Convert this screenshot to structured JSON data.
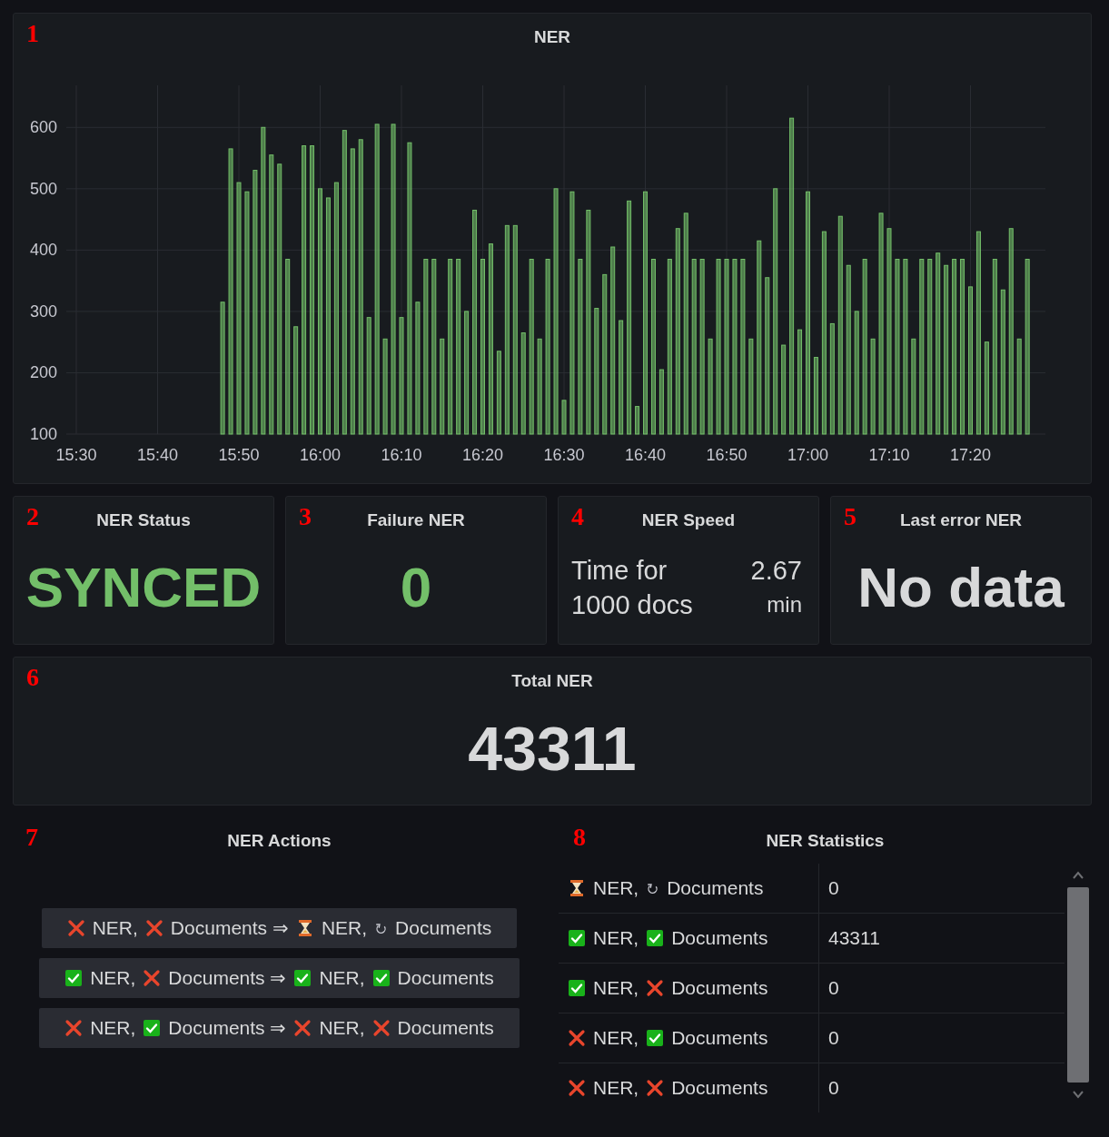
{
  "chart_panel": {
    "marker": "1",
    "title": "NER",
    "chart_data": {
      "type": "bar",
      "grid": true,
      "ylim": [
        100,
        670
      ],
      "yticks": [
        100,
        200,
        300,
        400,
        500,
        600
      ],
      "categories": [
        "15:30",
        null,
        null,
        null,
        null,
        null,
        null,
        null,
        null,
        null,
        "15:40",
        null,
        null,
        null,
        null,
        null,
        null,
        null,
        null,
        null,
        "15:50",
        null,
        null,
        null,
        null,
        null,
        null,
        null,
        null,
        null,
        "16:00",
        null,
        null,
        null,
        null,
        null,
        null,
        null,
        null,
        null,
        "16:10",
        null,
        null,
        null,
        null,
        null,
        null,
        null,
        null,
        null,
        "16:20",
        null,
        null,
        null,
        null,
        null,
        null,
        null,
        null,
        null,
        "16:30",
        null,
        null,
        null,
        null,
        null,
        null,
        null,
        null,
        null,
        "16:40",
        null,
        null,
        null,
        null,
        null,
        null,
        null,
        null,
        null,
        "16:50",
        null,
        null,
        null,
        null,
        null,
        null,
        null,
        null,
        null,
        "17:00",
        null,
        null,
        null,
        null,
        null,
        null,
        null,
        null,
        null,
        "17:10",
        null,
        null,
        null,
        null,
        null,
        null,
        null,
        null,
        null,
        "17:20",
        null,
        null,
        null,
        null,
        null,
        null,
        null,
        null,
        null
      ],
      "series": [
        {
          "color": "#73bf69",
          "values": [
            null,
            null,
            null,
            null,
            null,
            null,
            null,
            null,
            null,
            null,
            null,
            null,
            null,
            null,
            null,
            null,
            null,
            null,
            315,
            565,
            510,
            495,
            530,
            600,
            555,
            540,
            385,
            275,
            570,
            570,
            500,
            485,
            510,
            595,
            565,
            580,
            290,
            605,
            255,
            605,
            290,
            575,
            315,
            385,
            385,
            255,
            385,
            385,
            300,
            465,
            385,
            410,
            235,
            440,
            440,
            265,
            385,
            255,
            385,
            500,
            155,
            495,
            385,
            465,
            305,
            360,
            405,
            285,
            480,
            145,
            495,
            385,
            205,
            385,
            435,
            460,
            385,
            385,
            255,
            385,
            385,
            385,
            385,
            255,
            415,
            355,
            500,
            245,
            615,
            270,
            495,
            225,
            430,
            280,
            455,
            375,
            300,
            385,
            255,
            460,
            435,
            385,
            385,
            255,
            385,
            385,
            395,
            375,
            385,
            385,
            340,
            430,
            250,
            385,
            335,
            435,
            255,
            385,
            null,
            null
          ]
        }
      ]
    }
  },
  "stat_panels": [
    {
      "marker": "2",
      "title": "NER Status",
      "kind": "value",
      "value": "SYNCED",
      "color": "#73bf69"
    },
    {
      "marker": "3",
      "title": "Failure NER",
      "kind": "value",
      "value": "0",
      "color": "#73bf69"
    },
    {
      "marker": "4",
      "title": "NER Speed",
      "kind": "pair",
      "label": "Time for 1000 docs",
      "value": "2.67",
      "unit": "min",
      "color": "#d8d9da"
    },
    {
      "marker": "5",
      "title": "Last error NER",
      "kind": "value",
      "value": "No data",
      "color": "#d8d9da"
    }
  ],
  "total_panel": {
    "marker": "6",
    "title": "Total NER",
    "value": "43311"
  },
  "actions_panel": {
    "marker": "7",
    "title": "NER Actions",
    "actions": [
      {
        "from": [
          {
            "kind": "failed",
            "label": "NER,"
          },
          {
            "kind": "failed",
            "label": "Documents"
          }
        ],
        "arrow": "⇒",
        "to": [
          {
            "kind": "pending",
            "label": "NER,"
          },
          {
            "kind": "retry",
            "label": "Documents"
          }
        ]
      },
      {
        "from": [
          {
            "kind": "done",
            "label": "NER,"
          },
          {
            "kind": "failed",
            "label": "Documents"
          }
        ],
        "arrow": "⇒",
        "to": [
          {
            "kind": "done",
            "label": "NER,"
          },
          {
            "kind": "done",
            "label": "Documents"
          }
        ]
      },
      {
        "from": [
          {
            "kind": "failed",
            "label": "NER,"
          },
          {
            "kind": "done",
            "label": "Documents"
          }
        ],
        "arrow": "⇒",
        "to": [
          {
            "kind": "failed",
            "label": "NER,"
          },
          {
            "kind": "failed",
            "label": "Documents"
          }
        ]
      }
    ]
  },
  "statistics_panel": {
    "marker": "8",
    "title": "NER Statistics",
    "rows": [
      {
        "state": [
          {
            "kind": "pending",
            "label": "NER,"
          },
          {
            "kind": "retry",
            "label": "Documents"
          }
        ],
        "count": "0"
      },
      {
        "state": [
          {
            "kind": "done",
            "label": "NER,"
          },
          {
            "kind": "done",
            "label": "Documents"
          }
        ],
        "count": "43311"
      },
      {
        "state": [
          {
            "kind": "done",
            "label": "NER,"
          },
          {
            "kind": "failed",
            "label": "Documents"
          }
        ],
        "count": "0"
      },
      {
        "state": [
          {
            "kind": "failed",
            "label": "NER,"
          },
          {
            "kind": "done",
            "label": "Documents"
          }
        ],
        "count": "0"
      },
      {
        "state": [
          {
            "kind": "failed",
            "label": "NER,"
          },
          {
            "kind": "failed",
            "label": "Documents"
          }
        ],
        "count": "0"
      }
    ]
  }
}
